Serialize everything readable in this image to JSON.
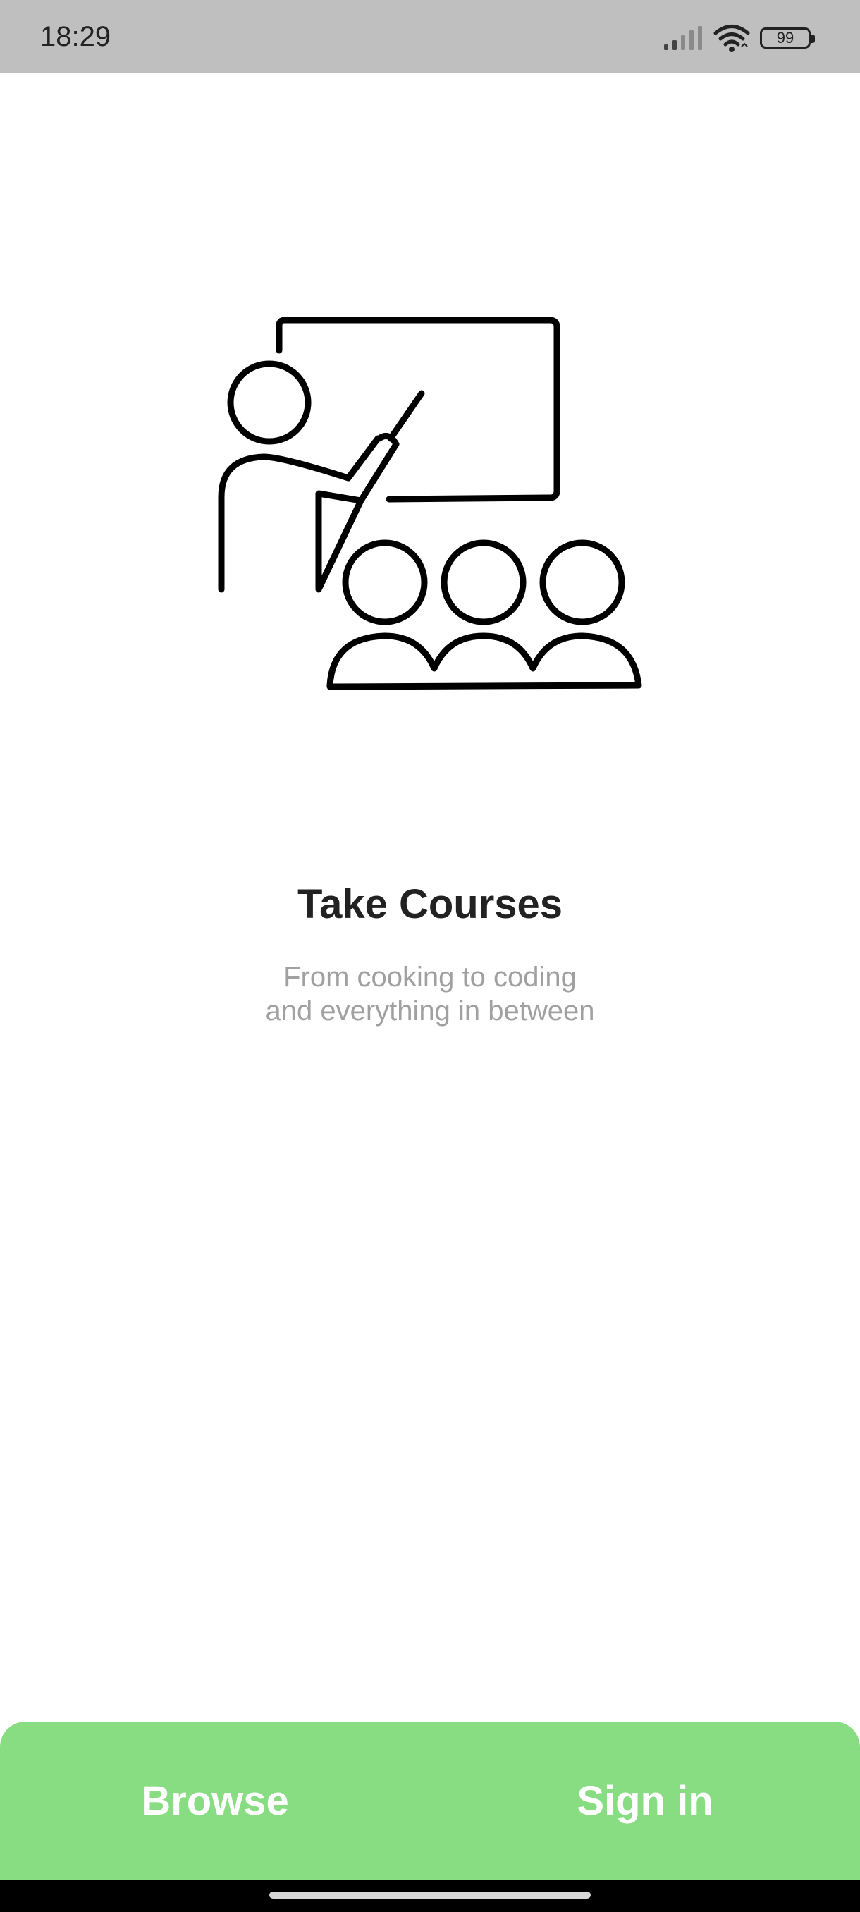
{
  "status_bar": {
    "time": "18:29",
    "battery_level": "99",
    "icons": [
      "signal-icon",
      "wifi-icon",
      "battery-icon"
    ]
  },
  "onboarding": {
    "illustration_icon": "teacher-presentation-icon",
    "title": "Take Courses",
    "subtitle_line1": "From cooking to coding",
    "subtitle_line2": "and everything in between"
  },
  "bottom_bar": {
    "browse_label": "Browse",
    "signin_label": "Sign in",
    "accent_color": "#88dd82"
  }
}
